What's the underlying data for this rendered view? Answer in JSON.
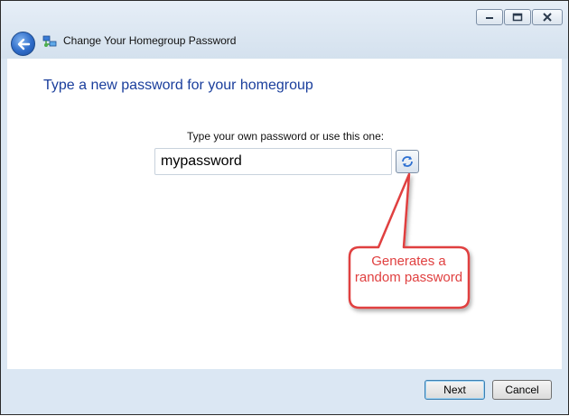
{
  "window": {
    "title": "Change Your Homegroup Password",
    "caption_buttons": [
      "minimize-icon",
      "maximize-icon",
      "close-icon"
    ]
  },
  "content": {
    "heading": "Type a new password for your homegroup",
    "prompt": "Type your own password or use this one:",
    "password_value": "mypassword",
    "callout_text": "Generates a random password"
  },
  "footer": {
    "next_label": "Next",
    "cancel_label": "Cancel"
  },
  "colors": {
    "heading": "#1a3e9c",
    "callout": "#e04040",
    "chrome": "#dbe7f3"
  }
}
